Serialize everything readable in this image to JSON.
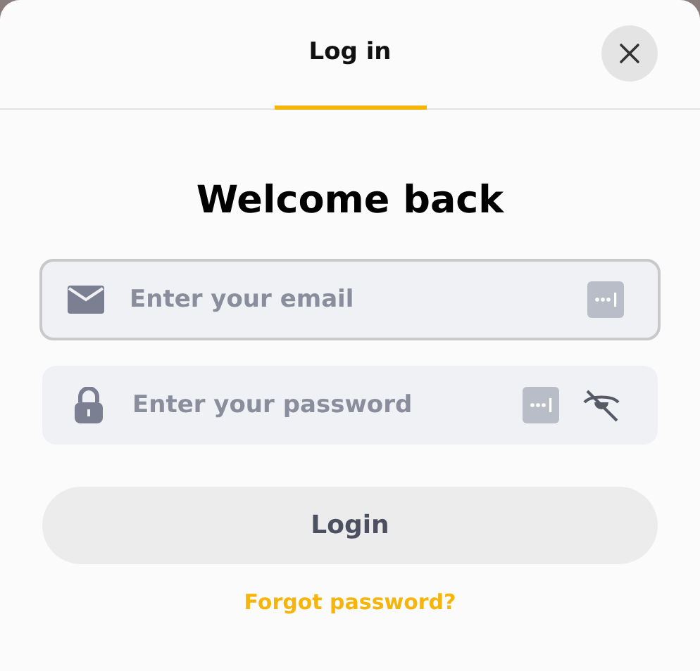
{
  "tabs": [
    {
      "label": "Log in",
      "selected": true
    }
  ],
  "heading": "Welcome back",
  "fields": [
    {
      "kind": "email",
      "placeholder": "Enter your email",
      "focused": true
    },
    {
      "kind": "password",
      "placeholder": "Enter your password",
      "focused": false,
      "password_visible": false
    }
  ],
  "submit_button": "Login",
  "forgot_link": "Forgot password?"
}
